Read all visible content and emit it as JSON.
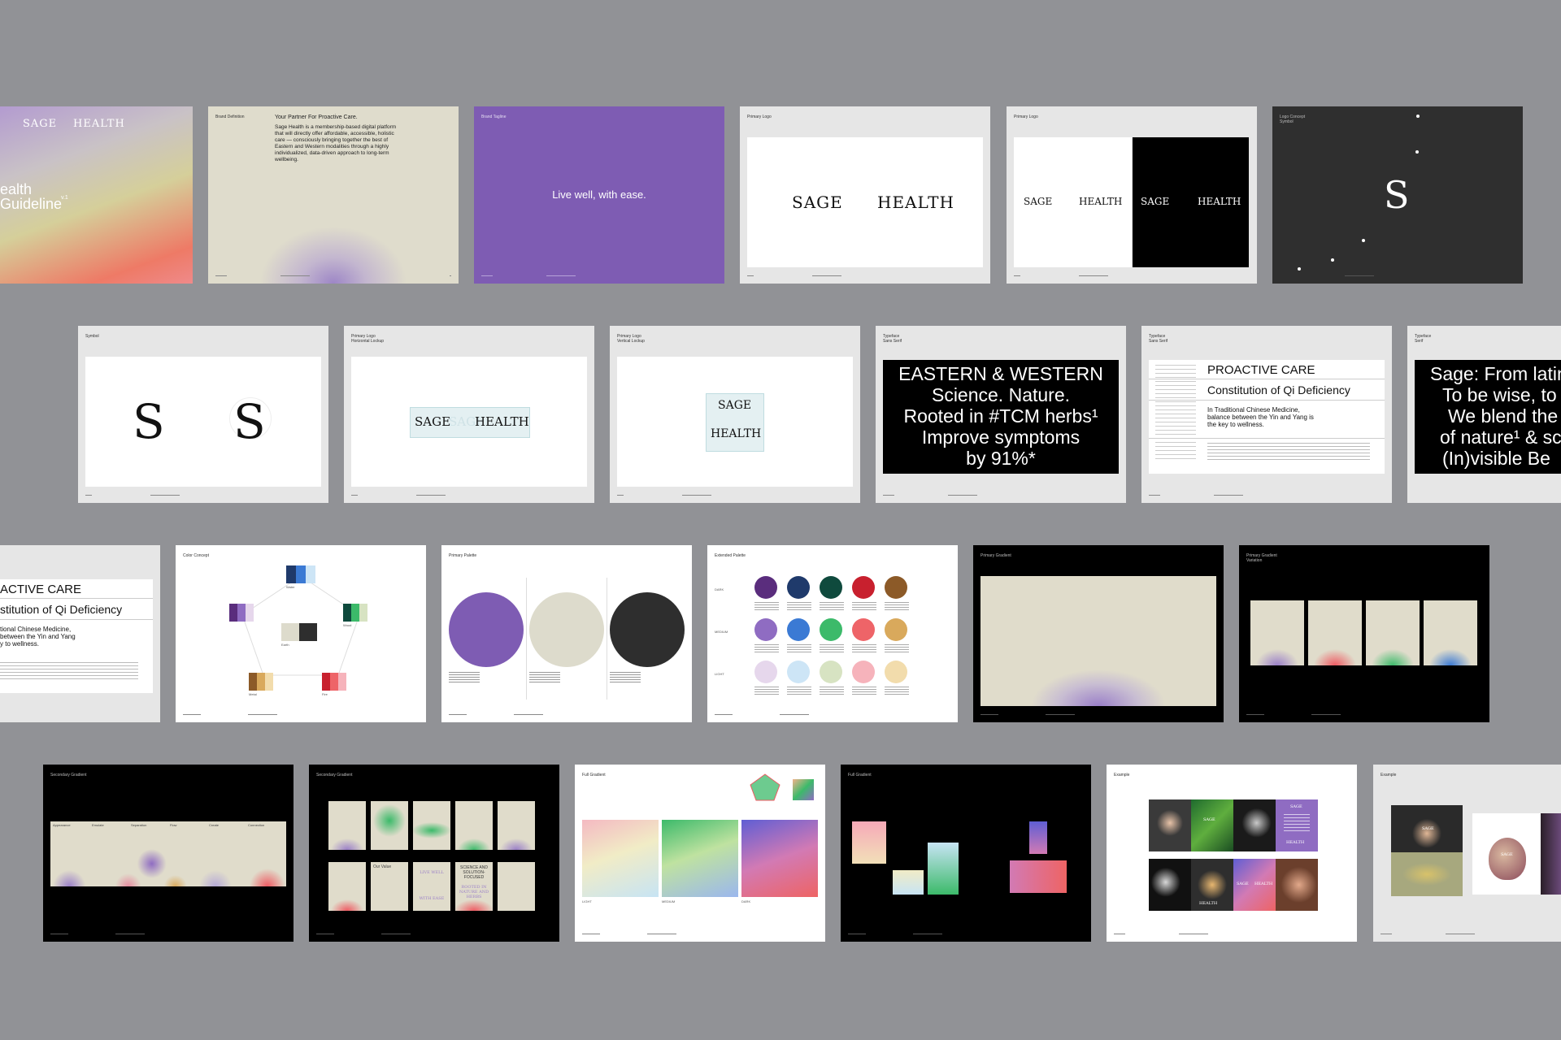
{
  "cover": {
    "sage": "SAGE",
    "health": "HEALTH",
    "title": "ealth\nGuideline",
    "version": "v.1"
  },
  "brand_definition": {
    "label": "Brand Definition",
    "heading": "Your Partner For Proactive Care.",
    "body": "Sage Health is a membership-based digital platform that will directly offer affordable, accessible, holistic care — consciously bringing together the best of Eastern and Western modalities through a highly individualized, data-driven approach to long-term wellbeing."
  },
  "tagline": {
    "label": "Brand Tagline",
    "text": "Live well, with ease."
  },
  "primary_logo": {
    "label": "Primary Logo",
    "sage": "SAGE",
    "health": "HEALTH"
  },
  "primary_logo_2": {
    "label": "Primary Logo",
    "sage": "SAGE",
    "health": "HEALTH"
  },
  "logo_concept": {
    "label": "Logo Concept\nSymbol",
    "symbol": "S"
  },
  "symbol": {
    "label": "Symbol",
    "glyph": "S"
  },
  "horizontal_lockup": {
    "label": "Primary Logo\nHorizontal Lockup",
    "sage": "SAGE",
    "health": "HEALTH"
  },
  "vertical_lockup": {
    "label": "Primary Logo\nVertical Lockup",
    "sage": "SAGE",
    "health": "HEALTH"
  },
  "typeface_sans": {
    "label": "Typeface\nSans Serif",
    "lines": [
      "EASTERN & WESTERN",
      "Science. Nature.",
      "Rooted in #TCM herbs¹",
      "Improve symptoms",
      "by 91%*"
    ]
  },
  "typeface_sans_2": {
    "label": "Typeface\nSans Serif",
    "headline": "PROACTIVE CARE",
    "sub": "Constitution of Qi Deficiency",
    "body": "In Traditional Chinese Medicine, balance between the Yin and Yang is the key to wellness."
  },
  "typeface_serif": {
    "label": "Typeface\nSerif",
    "lines": [
      "Sage: From latin",
      "To be wise, to",
      "We blend the",
      "of nature¹ & sc",
      "(In)visible Be"
    ]
  },
  "typeface_sans_3": {
    "headline": "ACTIVE CARE",
    "sub": "stitution of Qi Deficiency",
    "body_lines": [
      "tional Chinese Medicine,",
      "between the Yin and Yang",
      "y to wellness."
    ]
  },
  "color_concept": {
    "label": "Color Concept",
    "nodes": [
      "Water",
      "Wood",
      "Earth",
      "Fire",
      "Metal"
    ]
  },
  "primary_palette": {
    "label": "Primary Palette",
    "colors": [
      "#7e5cb3",
      "#dddbcc",
      "#2e2e2e"
    ]
  },
  "extended_palette": {
    "label": "Extended Palette",
    "rows": [
      "DARK",
      "MEDIUM",
      "LIGHT"
    ],
    "dark": [
      "#5a2d7d",
      "#1f3a6b",
      "#0f4a3d",
      "#c8202e",
      "#8c5a28"
    ],
    "medium": [
      "#8f6cc2",
      "#3b7ad4",
      "#3cba6a",
      "#ee6468",
      "#d9a95c"
    ],
    "light": [
      "#e6d7ec",
      "#cde5f6",
      "#d7e3c2",
      "#f6b3bb",
      "#f2dcac"
    ]
  },
  "primary_gradient": {
    "label": "Primary Gradient"
  },
  "primary_gradient_var": {
    "label": "Primary Gradient\nVariation"
  },
  "secondary_gradient": {
    "label": "Secondary Gradient",
    "steps": [
      "Appearance",
      "Emulate",
      "Separation",
      "Flow",
      "Create",
      "Connection"
    ]
  },
  "secondary_gradient_2": {
    "label": "Secondary Gradient",
    "card_texts": [
      "Our Value",
      "LIVE WELL",
      "WITH EASE",
      "SCIENCE AND SOLUTION-FOCUSED",
      "ROOTED IN NATURE AND HERBS"
    ]
  },
  "full_gradient": {
    "label": "Full Gradient",
    "captions": [
      "LIGHT",
      "MEDIUM",
      "DARK"
    ]
  },
  "full_gradient_2": {
    "label": "Full Gradient"
  },
  "example": {
    "label": "Example",
    "sage": "SAGE",
    "health": "HEALTH"
  },
  "example_2": {
    "label": "Example",
    "sage": "SAGE"
  },
  "colors": {
    "background": "#919296",
    "purple": "#7e5cb3",
    "beige": "#dddbcc",
    "dark": "#2e2e2e"
  }
}
